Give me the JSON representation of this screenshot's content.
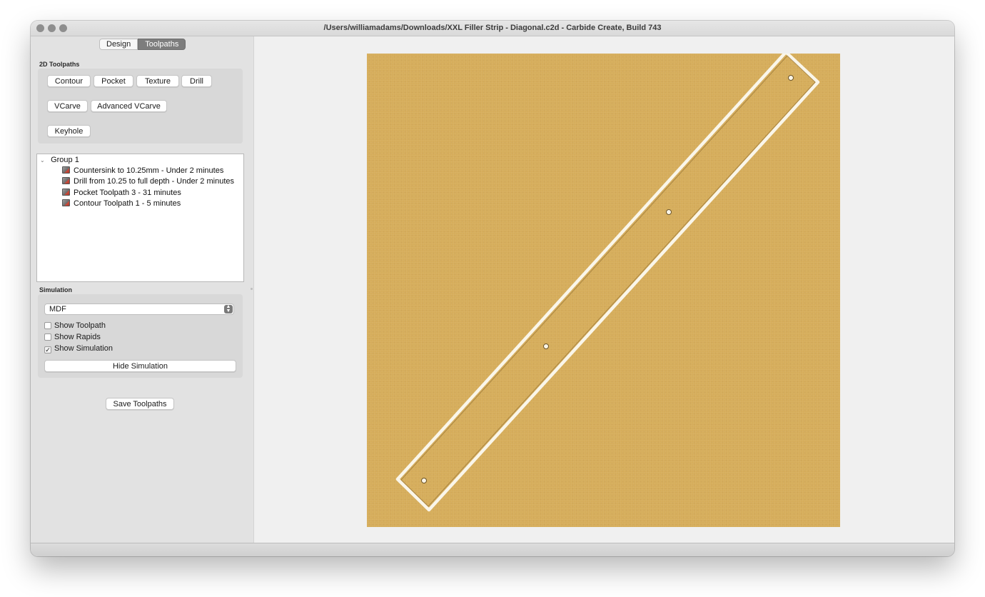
{
  "window": {
    "title": "/Users/williamadams/Downloads/XXL Filler Strip - Diagonal.c2d - Carbide Create, Build 743"
  },
  "tabs": [
    {
      "label": "Design",
      "active": false
    },
    {
      "label": "Toolpaths",
      "active": true
    }
  ],
  "toolpaths_2d": {
    "label": "2D Toolpaths",
    "buttons": {
      "contour": "Contour",
      "pocket": "Pocket",
      "texture": "Texture",
      "drill": "Drill",
      "vcarve": "VCarve",
      "advanced_vcarve": "Advanced VCarve",
      "keyhole": "Keyhole"
    }
  },
  "tree": {
    "group_label": "Group 1",
    "items": [
      {
        "label": "Countersink to 10.25mm - Under 2 minutes",
        "icon": "toolpath-op-icon"
      },
      {
        "label": "Drill from 10.25 to full depth - Under 2 minutes",
        "icon": "toolpath-op-icon"
      },
      {
        "label": "Pocket Toolpath 3 - 31 minutes",
        "icon": "toolpath-op-icon"
      },
      {
        "label": "Contour Toolpath 1 - 5 minutes",
        "icon": "toolpath-op-icon"
      }
    ]
  },
  "simulation": {
    "label": "Simulation",
    "material": "MDF",
    "show_toolpath": {
      "label": "Show Toolpath",
      "checked": false
    },
    "show_rapids": {
      "label": "Show Rapids",
      "checked": false
    },
    "show_simulation": {
      "label": "Show Simulation",
      "checked": true
    },
    "hide_button": "Hide Simulation"
  },
  "save_button": "Save Toolpaths",
  "colors": {
    "stock": "#d6ad5b",
    "cut": "#faf6ea",
    "active_tab": "#7d7d7d"
  }
}
